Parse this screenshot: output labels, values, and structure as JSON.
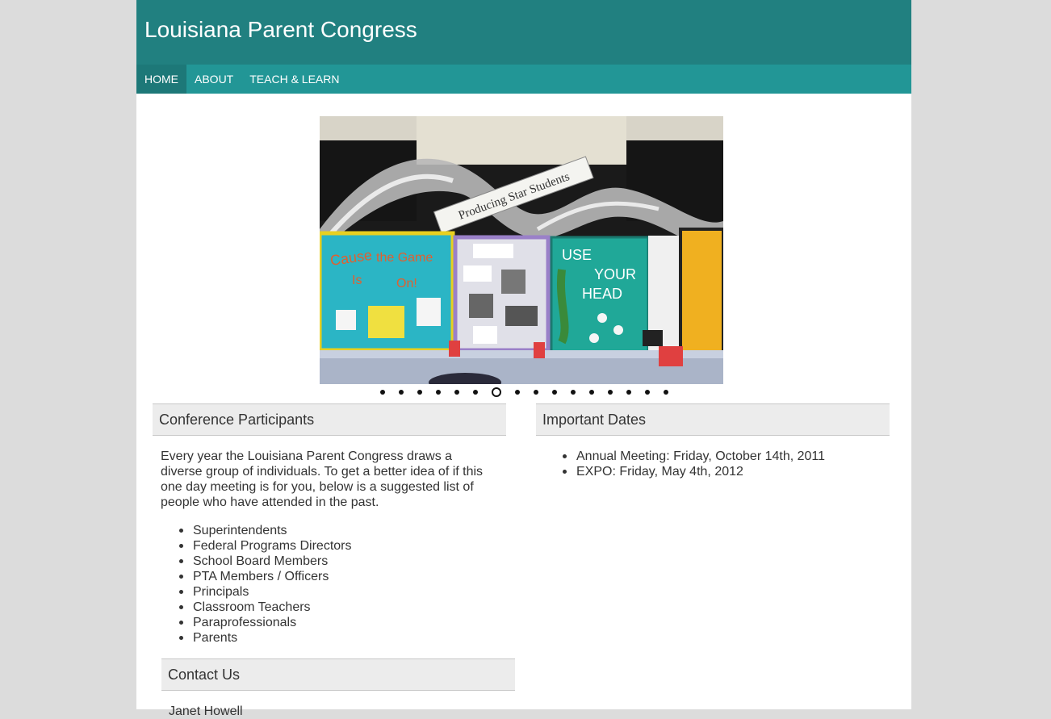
{
  "site": {
    "title": "Louisiana Parent Congress"
  },
  "nav": {
    "items": [
      "HOME",
      "ABOUT",
      "TEACH & LEARN"
    ],
    "active_index": 0
  },
  "slideshow": {
    "banner_text": "Producing Star Students",
    "dot_count": 16,
    "active_index": 6
  },
  "participants": {
    "heading": "Conference Participants",
    "intro": "Every year the Louisiana Parent Congress draws a diverse group of individuals. To get a better idea of if this one day meeting is for you, below is a suggested list of people who have attended in the past.",
    "items": [
      "Superintendents",
      "Federal Programs Directors",
      "School Board Members",
      "PTA Members / Officers",
      "Principals",
      "Classroom Teachers",
      "Paraprofessionals",
      "Parents"
    ]
  },
  "dates": {
    "heading": "Important Dates",
    "items": [
      "Annual Meeting: Friday, October 14th, 2011",
      "EXPO: Friday, May 4th, 2012"
    ]
  },
  "contact": {
    "heading": "Contact Us",
    "name": "Janet Howell"
  },
  "colors": {
    "header": "#218080",
    "nav": "#229696",
    "nav_active": "#1d7878",
    "page_bg": "#dcdcdc",
    "heading_bg": "#ececec"
  }
}
